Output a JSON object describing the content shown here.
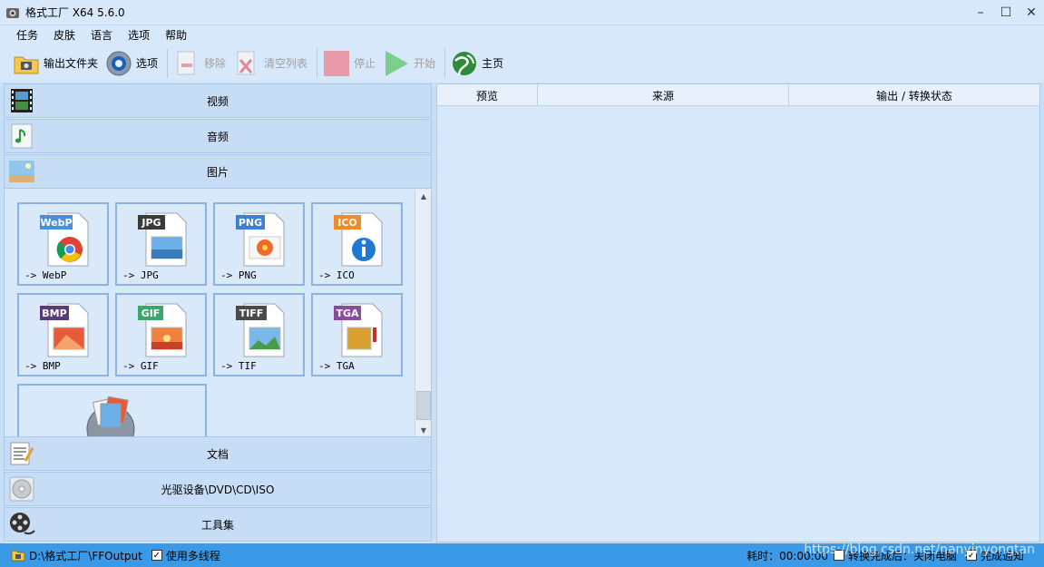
{
  "window": {
    "title": "格式工厂 X64 5.6.0",
    "minimize": "–",
    "maximize": "☐",
    "close": "✕"
  },
  "menu": [
    "任务",
    "皮肤",
    "语言",
    "选项",
    "帮助"
  ],
  "toolbar": {
    "output_folder": "输出文件夹",
    "options": "选项",
    "remove": "移除",
    "clear_list": "清空列表",
    "stop": "停止",
    "start": "开始",
    "home": "主页"
  },
  "categories": {
    "video": "视频",
    "audio": "音频",
    "image": "图片",
    "document": "文档",
    "optical": "光驱设备\\DVD\\CD\\ISO",
    "tools": "工具集"
  },
  "image_formats": [
    {
      "badge": "WebP",
      "label": "-> WebP",
      "color": "#4a8fdc"
    },
    {
      "badge": "JPG",
      "label": "-> JPG",
      "color": "#3a3a3a"
    },
    {
      "badge": "PNG",
      "label": "-> PNG",
      "color": "#3e7fd6"
    },
    {
      "badge": "ICO",
      "label": "-> ICO",
      "color": "#f08a2a"
    },
    {
      "badge": "BMP",
      "label": "-> BMP",
      "color": "#5a3a7a"
    },
    {
      "badge": "GIF",
      "label": "-> GIF",
      "color": "#3aa86a"
    },
    {
      "badge": "TIFF",
      "label": "-> TIF",
      "color": "#4a4a4a"
    },
    {
      "badge": "TGA",
      "label": "-> TGA",
      "color": "#8a4aa0"
    }
  ],
  "table": {
    "col_preview": "预览",
    "col_source": "来源",
    "col_output": "输出 / 转换状态"
  },
  "status": {
    "output_path": "D:\\格式工厂\\FFOutput",
    "multithread": "使用多线程",
    "elapsed": "耗时：00:00:00",
    "after_convert": "转换完成后：关闭电脑",
    "done_notify": "完成通知"
  },
  "watermark": "https://blog.csdn.net/nanyinyongtan",
  "colors": {
    "status_bar": "#3a9ae8",
    "panel_bg": "#d6e8fa",
    "tile_border": "#8bb4e6"
  }
}
